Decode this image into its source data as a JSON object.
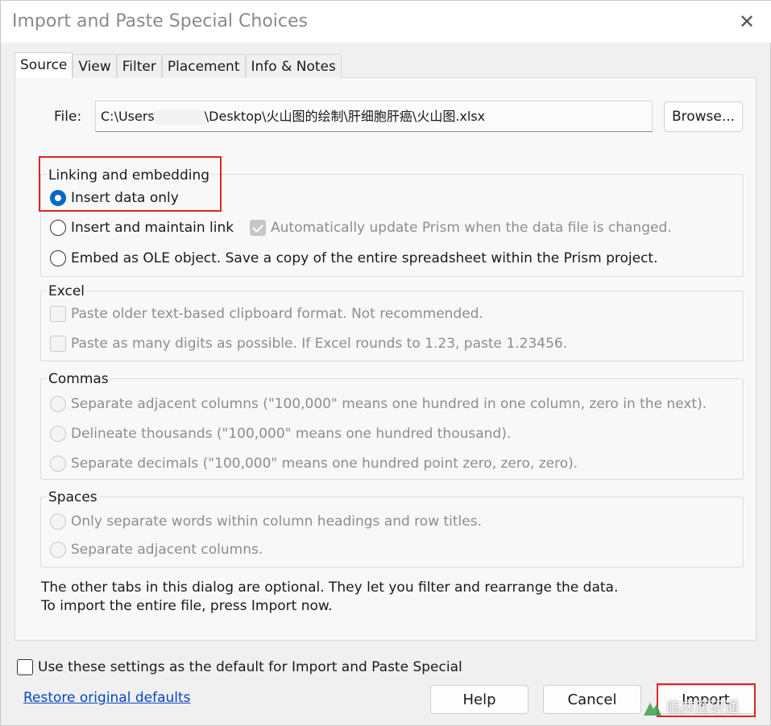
{
  "window": {
    "title": "Import and Paste Special Choices",
    "close_glyph": "✕"
  },
  "tabs": [
    {
      "label": "Source",
      "active": true
    },
    {
      "label": "View"
    },
    {
      "label": "Filter"
    },
    {
      "label": "Placement"
    },
    {
      "label": "Info & Notes"
    }
  ],
  "file": {
    "label": "File:",
    "path_prefix": "C:\\Users",
    "path_suffix": "\\Desktop\\火山图的绘制\\肝细胞肝癌\\火山图.xlsx",
    "browse_label": "Browse..."
  },
  "linking": {
    "legend": "Linking and embedding",
    "insert_data_only": "Insert data only",
    "insert_maintain_link": "Insert and maintain link",
    "auto_update": "Automatically update Prism when the data file is changed.",
    "embed_ole": "Embed as OLE object. Save a copy of the entire spreadsheet within the Prism project.",
    "selected": "insert_data_only"
  },
  "excel": {
    "legend": "Excel",
    "paste_older": "Paste older text-based clipboard format. Not recommended.",
    "paste_digits": "Paste as many digits as possible. If Excel rounds to 1.23, paste 1.23456."
  },
  "commas": {
    "legend": "Commas",
    "separate_columns": "Separate adjacent columns (\"100,000\" means one hundred in one column, zero in the next).",
    "delineate_thousands": "Delineate thousands (\"100,000\" means one hundred thousand).",
    "separate_decimals": "Separate decimals (\"100,000\" means one hundred point zero, zero, zero)."
  },
  "spaces": {
    "legend": "Spaces",
    "only_words": "Only separate words within column headings and row titles.",
    "separate_columns": "Separate adjacent columns."
  },
  "notes": {
    "line1": "The other tabs in this dialog are optional. They let you filter and rearrange the data.",
    "line2": "To import the entire file, press Import now."
  },
  "footer": {
    "default_check": "Use these settings as the default for Import and Paste Special",
    "restore_link": "Restore original defaults",
    "help": "Help",
    "cancel": "Cancel",
    "import": "Import"
  },
  "watermark": {
    "text": "临床医研通"
  },
  "colors": {
    "accent": "#0067c0",
    "highlight": "#e02424",
    "link": "#0645c4"
  }
}
